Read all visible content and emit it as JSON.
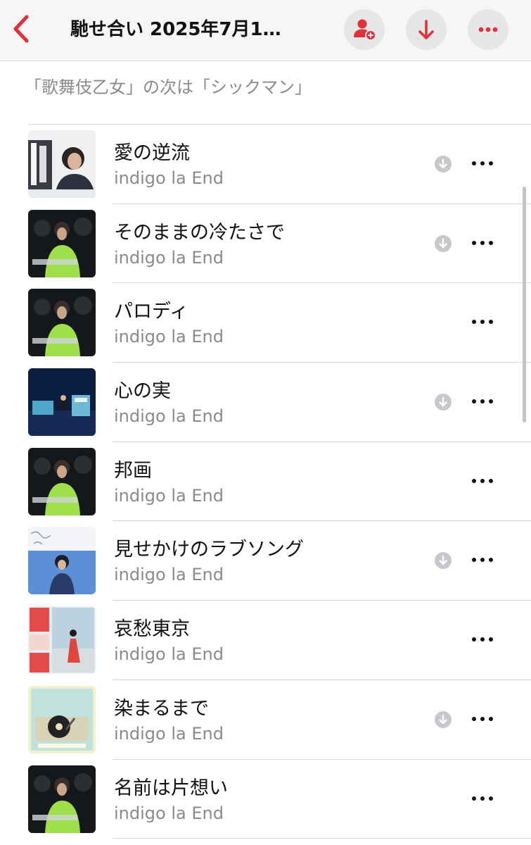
{
  "nav": {
    "title": "馳せ合い 2025年7月1…",
    "accent": "#e0303a",
    "back_icon": "chevron-left-icon",
    "add_user_icon": "person-add-icon",
    "download_icon": "arrow-down-icon",
    "more_icon": "ellipsis-icon"
  },
  "note": "「歌舞伎乙女」の次は「シックマン」",
  "tracks": [
    {
      "title": "愛の逆流",
      "artist": "indigo la End",
      "downloaded": true
    },
    {
      "title": "そのままの冷たさで",
      "artist": "indigo la End",
      "downloaded": true
    },
    {
      "title": "パロディ",
      "artist": "indigo la End",
      "downloaded": false
    },
    {
      "title": "心の実",
      "artist": "indigo la End",
      "downloaded": true
    },
    {
      "title": "邦画",
      "artist": "indigo la End",
      "downloaded": false
    },
    {
      "title": "見せかけのラブソング",
      "artist": "indigo la End",
      "downloaded": true
    },
    {
      "title": "哀愁東京",
      "artist": "indigo la End",
      "downloaded": false
    },
    {
      "title": "染まるまで",
      "artist": "indigo la End",
      "downloaded": true
    },
    {
      "title": "名前は片想い",
      "artist": "indigo la End",
      "downloaded": false
    }
  ]
}
